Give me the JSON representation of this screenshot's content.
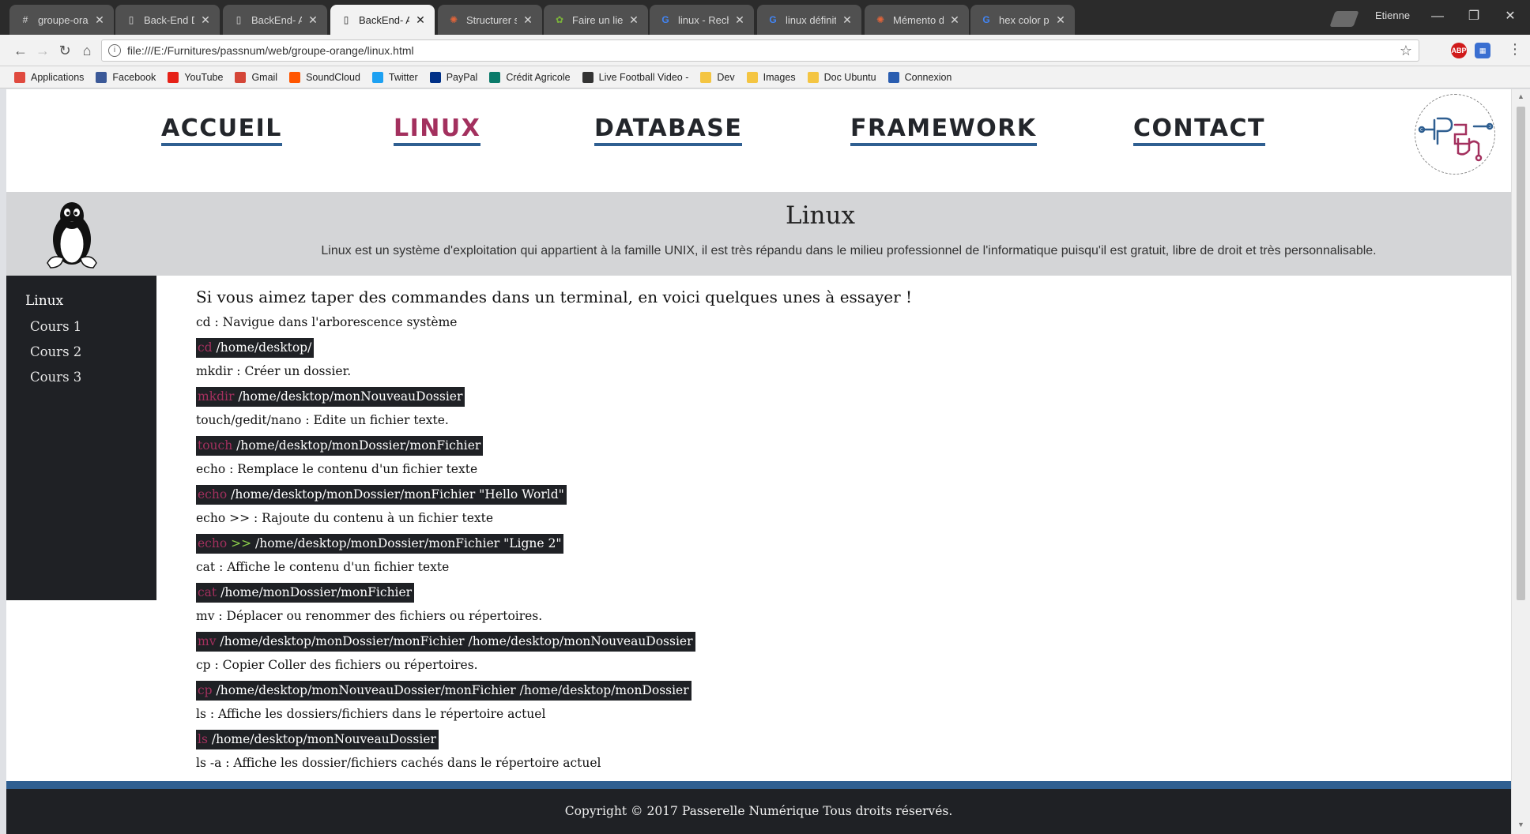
{
  "browser": {
    "tabs": [
      {
        "title": "groupe-orange | Pa",
        "favicon": "hash-icon"
      },
      {
        "title": "Back-End Developm",
        "favicon": "page-icon"
      },
      {
        "title": "BackEnd- Accueil",
        "favicon": "page-icon"
      },
      {
        "title": "BackEnd- Accueil",
        "favicon": "page-icon",
        "active": true
      },
      {
        "title": "Structurer sa page -",
        "favicon": "openclassrooms-icon"
      },
      {
        "title": "Faire un lien vers un",
        "favicon": "site-icon"
      },
      {
        "title": "linux - Recherche G",
        "favicon": "google-icon"
      },
      {
        "title": "linux définition - Re",
        "favicon": "google-icon"
      },
      {
        "title": "Mémento des balis",
        "favicon": "openclassrooms-icon"
      },
      {
        "title": "hex color picker - R",
        "favicon": "google-icon"
      }
    ],
    "tab_close": "✕",
    "profile": "Etienne",
    "address": "file:///E:/Furnitures/passnum/web/groupe-orange/linux.html",
    "bookmarks": [
      {
        "label": "Applications",
        "icon": "apps-grid-icon",
        "color": "#e04a3f"
      },
      {
        "label": "Facebook",
        "icon": "facebook-icon",
        "color": "#3b5998"
      },
      {
        "label": "YouTube",
        "icon": "youtube-icon",
        "color": "#e62117"
      },
      {
        "label": "Gmail",
        "icon": "gmail-icon",
        "color": "#d44638"
      },
      {
        "label": "SoundCloud",
        "icon": "soundcloud-icon",
        "color": "#ff5500"
      },
      {
        "label": "Twitter",
        "icon": "twitter-icon",
        "color": "#1da1f2"
      },
      {
        "label": "PayPal",
        "icon": "paypal-icon",
        "color": "#003087"
      },
      {
        "label": "Crédit Agricole",
        "icon": "credit-agricole-icon",
        "color": "#0a7a6a"
      },
      {
        "label": "Live Football Video -",
        "icon": "football-icon",
        "color": "#333333"
      },
      {
        "label": "Dev",
        "icon": "folder-icon",
        "color": "#f4c542"
      },
      {
        "label": "Images",
        "icon": "folder-icon",
        "color": "#f4c542"
      },
      {
        "label": "Doc Ubuntu",
        "icon": "folder-icon",
        "color": "#f4c542"
      },
      {
        "label": "Connexion",
        "icon": "globe-icon",
        "color": "#2a5db0"
      }
    ]
  },
  "site": {
    "nav": [
      {
        "label": "ACCUEIL",
        "active": false
      },
      {
        "label": "LINUX",
        "active": true
      },
      {
        "label": "DATABASE",
        "active": false
      },
      {
        "label": "FRAMEWORK",
        "active": false
      },
      {
        "label": "CONTACT",
        "active": false
      }
    ],
    "colors": {
      "accent": "#a3305e",
      "nav_underline": "#2f5f91",
      "dark": "#1f2125",
      "banner": "#d4d5d7",
      "cmd_operator": "#8ed14a"
    },
    "banner": {
      "title": "Linux",
      "description": "Linux est un système d'exploitation qui appartient à la famille UNIX, il est très répandu dans le milieu professionnel de l'informatique puisqu'il est gratuit, libre de droit et très personnalisable."
    },
    "sidebar": {
      "title": "Linux",
      "items": [
        "Cours 1",
        "Cours 2",
        "Cours 3"
      ]
    },
    "content": {
      "heading": "Si vous aimez taper des commandes dans un terminal, en voici quelques unes à essayer !",
      "commands": [
        {
          "desc": "cd : Navigue dans l'arborescence système",
          "keyword": "cd",
          "operator": "",
          "args": "/home/desktop/"
        },
        {
          "desc": "mkdir : Créer un dossier.",
          "keyword": "mkdir",
          "operator": "",
          "args": "/home/desktop/monNouveauDossier"
        },
        {
          "desc": "touch/gedit/nano : Edite un fichier texte.",
          "keyword": "touch",
          "operator": "",
          "args": "/home/desktop/monDossier/monFichier"
        },
        {
          "desc": "echo : Remplace le contenu d'un fichier texte",
          "keyword": "echo",
          "operator": "",
          "args": "/home/desktop/monDossier/monFichier \"Hello World\""
        },
        {
          "desc": "echo >> : Rajoute du contenu à un fichier texte",
          "keyword": "echo",
          "operator": ">>",
          "args": "/home/desktop/monDossier/monFichier \"Ligne 2\""
        },
        {
          "desc": "cat : Affiche le contenu d'un fichier texte",
          "keyword": "cat",
          "operator": "",
          "args": "/home/monDossier/monFichier"
        },
        {
          "desc": "mv : Déplacer ou renommer des fichiers ou répertoires.",
          "keyword": "mv",
          "operator": "",
          "args": "/home/desktop/monDossier/monFichier /home/desktop/monNouveauDossier"
        },
        {
          "desc": "cp : Copier Coller des fichiers ou répertoires.",
          "keyword": "cp",
          "operator": "",
          "args": "/home/desktop/monNouveauDossier/monFichier /home/desktop/monDossier"
        },
        {
          "desc": "ls : Affiche les dossiers/fichiers dans le répertoire actuel",
          "keyword": "ls",
          "operator": "",
          "args": "/home/desktop/monNouveauDossier"
        },
        {
          "desc": "ls -a : Affiche les dossier/fichiers cachés dans le répertoire actuel",
          "keyword": "",
          "operator": "",
          "args": ""
        }
      ]
    },
    "footer": "Copyright © 2017 Passerelle Numérique Tous droits réservés."
  }
}
